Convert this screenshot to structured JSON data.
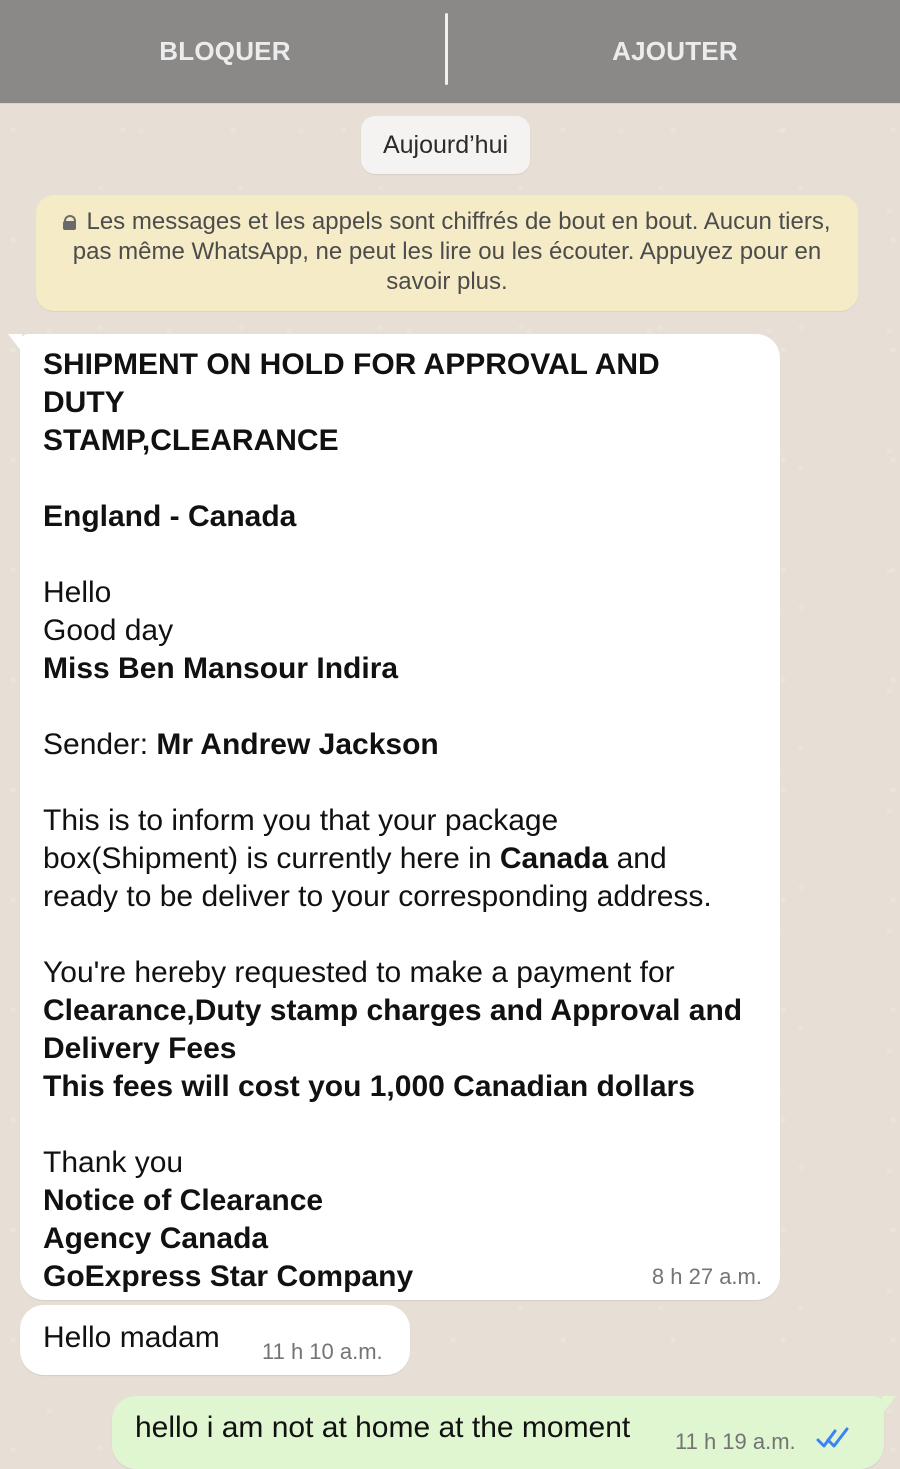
{
  "header": {
    "block_label": "BLOQUER",
    "add_label": "AJOUTER"
  },
  "chat": {
    "date_label": "Aujourd’hui",
    "encryption_notice": "Les messages et les appels sont chiffrés de bout en bout. Aucun tiers, pas même WhatsApp, ne peut les lire ou les écouter. Appuyez pour en savoir plus.",
    "messages": [
      {
        "direction": "incoming",
        "time": "8 h 27 a.m.",
        "lines": {
          "heading_1": "SHIPMENT ON HOLD FOR APPROVAL AND DUTY",
          "heading_2": "STAMP,CLEARANCE",
          "route": "England - Canada",
          "greeting_1": "Hello",
          "greeting_2": "Good day",
          "recipient": "Miss Ben Mansour Indira",
          "sender_label": "Sender: ",
          "sender_name": "Mr Andrew Jackson",
          "info_1": "This is to inform you that your package",
          "info_2_prefix": "box(Shipment) is currently here in ",
          "info_2_bold": "Canada",
          "info_2_suffix": " and",
          "info_3": "ready to be deliver to your corresponding address.",
          "request_1": "You're hereby requested to make a payment for",
          "request_2": "Clearance,Duty stamp charges and Approval and",
          "request_3": "Delivery Fees",
          "request_4": "This fees will cost you 1,000 Canadian dollars",
          "thanks": "Thank you",
          "signature_1": "Notice of Clearance",
          "signature_2": "Agency Canada",
          "signature_3": "GoExpress Star Company"
        }
      },
      {
        "direction": "incoming",
        "text": "Hello madam",
        "time": "11 h 10 a.m."
      },
      {
        "direction": "outgoing",
        "text": "hello i am not at home at the moment",
        "time": "11 h 19 a.m.",
        "status_icon": "double-check-read-icon"
      }
    ]
  },
  "colors": {
    "background": "#e7dfd6",
    "header": "#8a8988",
    "outgoing_bubble": "#dff6d1",
    "notice_bubble": "#f5ebc6",
    "read_receipt": "#3b82f6"
  }
}
